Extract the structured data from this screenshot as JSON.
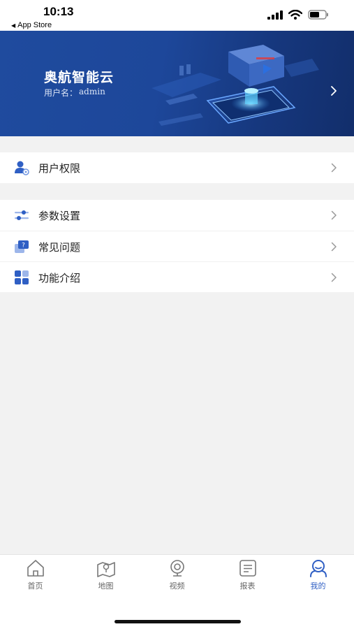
{
  "status_bar": {
    "time": "10:13",
    "back_label": "App Store"
  },
  "header": {
    "app_name": "奥航智能云",
    "user_prefix": "用户名：",
    "username": "admin"
  },
  "groups": [
    {
      "items": [
        {
          "label": "用户权限",
          "icon": "user-permission-icon"
        }
      ]
    },
    {
      "items": [
        {
          "label": "参数设置",
          "icon": "sliders-icon"
        },
        {
          "label": "常见问题",
          "icon": "question-chat-icon"
        },
        {
          "label": "功能介绍",
          "icon": "grid-apps-icon"
        }
      ]
    }
  ],
  "tabs": [
    {
      "label": "首页",
      "icon": "home-icon",
      "active": false
    },
    {
      "label": "地图",
      "icon": "map-icon",
      "active": false
    },
    {
      "label": "视频",
      "icon": "camera-icon",
      "active": false
    },
    {
      "label": "报表",
      "icon": "report-icon",
      "active": false
    },
    {
      "label": "我的",
      "icon": "profile-icon",
      "active": true
    }
  ],
  "colors": {
    "banner": "#1f4b9e",
    "accent": "#2f5fc4",
    "background": "#f2f2f2"
  }
}
